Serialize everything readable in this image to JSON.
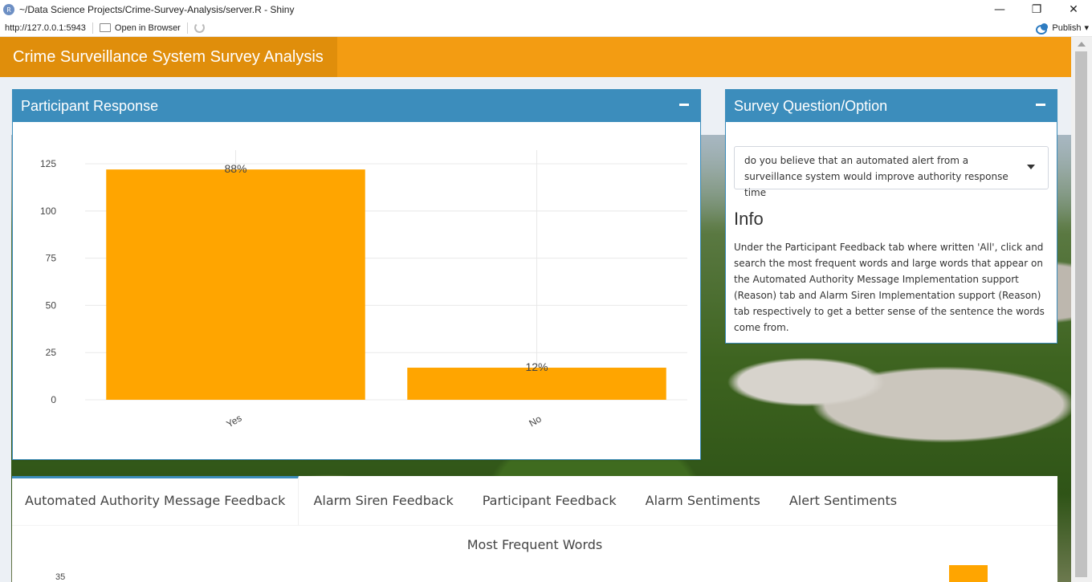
{
  "window": {
    "title": "~/Data Science Projects/Crime-Survey-Analysis/server.R - Shiny",
    "app_icon_letter": "R",
    "minimize": "—",
    "restore": "❐",
    "close": "✕"
  },
  "toolbar": {
    "url": "http://127.0.0.1:5943",
    "open_in_browser": "Open in Browser",
    "publish": "Publish",
    "publish_caret": "▾"
  },
  "app": {
    "title": "Crime Surveillance System Survey Analysis"
  },
  "participant_box": {
    "title": "Participant Response"
  },
  "question_box": {
    "title": "Survey Question/Option",
    "selected_option": "do you believe that an automated alert from a surveillance system would improve authority response time",
    "info_title": "Info",
    "info_text": "Under the Participant Feedback tab where written 'All', click and search the most frequent words and large words that appear on the Automated Authority Message Implementation support (Reason) tab and Alarm Siren Implementation support (Reason) tab respectively to get a better sense of the sentence the words come from."
  },
  "tabs": [
    {
      "label": "Automated Authority Message Feedback",
      "active": true
    },
    {
      "label": "Alarm Siren Feedback",
      "active": false
    },
    {
      "label": "Participant Feedback",
      "active": false
    },
    {
      "label": "Alarm Sentiments",
      "active": false
    },
    {
      "label": "Alert Sentiments",
      "active": false
    }
  ],
  "lower_section": {
    "title": "Most Frequent Words",
    "first_ytick": "35"
  },
  "chart_data": {
    "type": "bar",
    "categories": [
      "Yes",
      "No"
    ],
    "values": [
      122,
      17
    ],
    "data_labels": [
      "88%",
      "12%"
    ],
    "yticks": [
      0,
      25,
      50,
      75,
      100,
      125
    ],
    "ylim": [
      0,
      128
    ],
    "bar_color": "#ffa500",
    "grid": true
  },
  "colors": {
    "header": "#f39c12",
    "logo": "#e08e0b",
    "box_header": "#3c8dbc",
    "bar": "#ffa500"
  }
}
